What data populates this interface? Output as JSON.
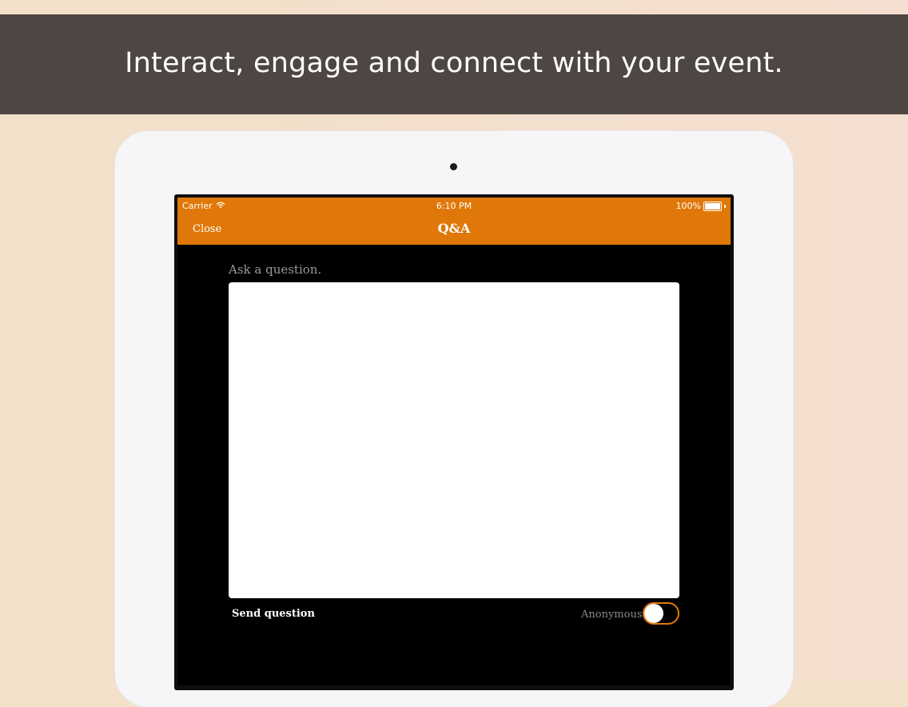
{
  "banner": {
    "text": "Interact, engage and connect with your event."
  },
  "status_bar": {
    "carrier": "Carrier",
    "time": "6:10 PM",
    "battery": "100%"
  },
  "nav": {
    "close_label": "Close",
    "title": "Q&A"
  },
  "form": {
    "prompt_label": "Ask a question.",
    "question_value": "",
    "send_label": "Send question",
    "anonymous_label": "Anonymous",
    "anonymous_on": false
  },
  "icons": {
    "wifi": "wifi-icon",
    "battery": "battery-icon"
  },
  "colors": {
    "accent": "#e07809",
    "banner": "#4e4642",
    "background": "#f3e1ca",
    "screen": "#000000"
  }
}
